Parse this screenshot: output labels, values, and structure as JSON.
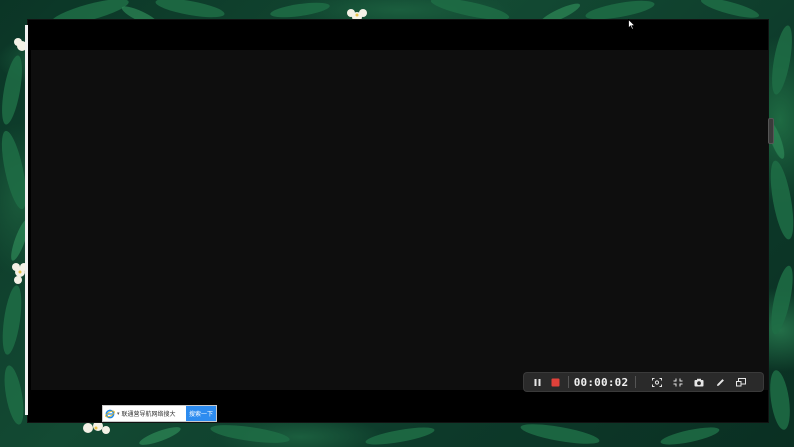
{
  "recorder": {
    "timer": "00:00:02",
    "colors": {
      "toolbar_bg": "#2a2a2a",
      "stop_red": "#e0413a",
      "icon_white": "#e6e6e6"
    },
    "controls": [
      {
        "name": "pause-icon"
      },
      {
        "name": "stop-record-icon"
      },
      {
        "name": "region-select-icon"
      },
      {
        "name": "fullscreen-icon"
      },
      {
        "name": "camera-icon"
      },
      {
        "name": "pen-annotate-icon"
      },
      {
        "name": "pip-window-icon"
      }
    ]
  },
  "search_widget": {
    "text": "联通营导航网络搜大",
    "button_label": "搜索一下",
    "accent": "#2d8cf0"
  }
}
